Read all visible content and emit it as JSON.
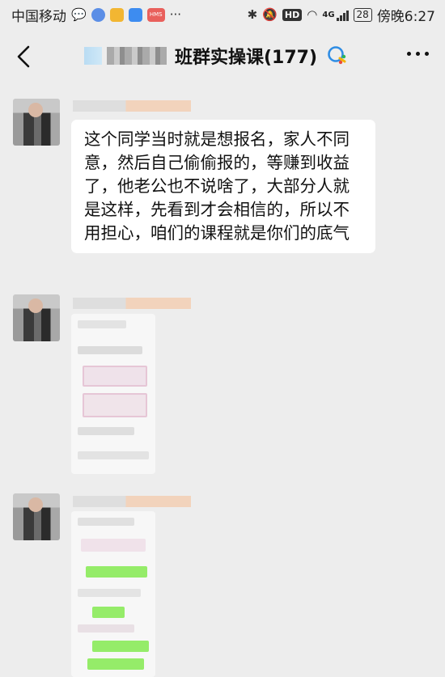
{
  "status_bar": {
    "carrier": "中国移动",
    "network": "4G",
    "battery": "28",
    "time": "傍晚6:27",
    "hd_label": "HD",
    "app_badge": "HMS"
  },
  "header": {
    "title": "班群实操课(177)"
  },
  "messages": [
    {
      "type": "text",
      "text": "这个同学当时就是想报名，家人不同意，然后自己偷偷报的，等赚到收益了，他老公也不说啥了，大部分人就是这样，先看到才会相信的，所以不用担心，咱们的课程就是你们的底气"
    },
    {
      "type": "image"
    },
    {
      "type": "image"
    }
  ],
  "colors": {
    "background": "#ededed",
    "bubble": "#ffffff",
    "chat_green": "#95ec69"
  }
}
